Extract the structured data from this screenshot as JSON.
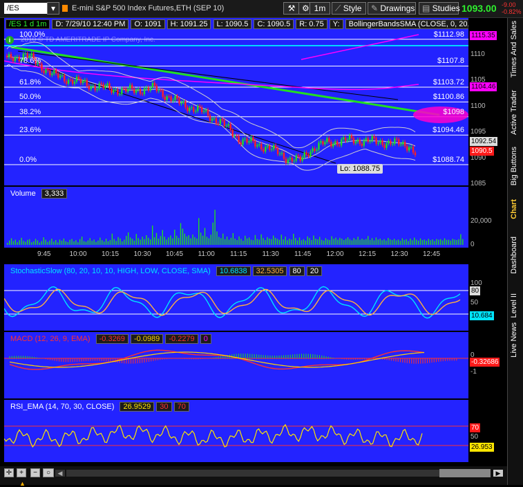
{
  "toolbar": {
    "symbol": "/ES",
    "title": "E-mini S&P 500 Index Futures,ETH (SEP 10)",
    "interval": "1m",
    "style_label": "Style",
    "drawings_label": "Drawings",
    "studies_label": "Studies",
    "last_price": "1093.00",
    "change_top": "-9.00",
    "change_pct": "-0.82%"
  },
  "chart_header": {
    "symbol_tf": "/ES 1 d 1m",
    "date": "D: 7/29/10 12:40 PM",
    "open": "O: 1091",
    "high": "H: 1091.25",
    "low": "L: 1090.5",
    "close": "C: 1090.5",
    "range": "R: 0.75",
    "y": "Y:",
    "study": "BollingerBandsSMA (CLOSE, 0, 20, -2.0, ..."
  },
  "watermark": "2010 © TD AMERITRADE IP Company, Inc.",
  "fib": [
    {
      "pct": "100.0%",
      "price": "$1112.98"
    },
    {
      "pct": "78.6%",
      "price": "$1107.8"
    },
    {
      "pct": "61.8%",
      "price": "$1103.72"
    },
    {
      "pct": "50.0%",
      "price": "$1100.86"
    },
    {
      "pct": "38.2%",
      "price": "$1098"
    },
    {
      "pct": "23.6%",
      "price": "$1094.46"
    },
    {
      "pct": "0.0%",
      "price": "$1088.74"
    }
  ],
  "low_label": "Lo: 1088.75",
  "price_axis": {
    "ticks": [
      "1110",
      "1105",
      "1100",
      "1095",
      "1090",
      "1085"
    ],
    "labels": {
      "top_magenta": "1115.35",
      "magenta_2": "1104.46",
      "bubble": "1092.54",
      "last": "1090.5"
    }
  },
  "volume": {
    "title": "Volume",
    "value": "3,333",
    "axis": [
      "20,000",
      "0"
    ],
    "bars": [
      1200,
      2500,
      3800,
      2200,
      3000,
      1500,
      2700,
      4100,
      2300,
      1800,
      2900,
      3300,
      1500,
      2000,
      3500,
      2600,
      1300,
      2200,
      4400,
      3000,
      1700,
      2500,
      3600,
      1900,
      2800,
      1400,
      3100,
      2400,
      3700,
      2100,
      1600,
      2900,
      3400,
      2000,
      2700,
      1500,
      3300,
      4800,
      2200,
      1800,
      2600,
      3900,
      2300,
      3100,
      1700,
      2500,
      4200,
      2700,
      1900,
      3600,
      2100,
      2800,
      6500,
      3400,
      2300,
      4500,
      3700,
      2000,
      3000,
      5200,
      7200,
      4300,
      3600,
      2500,
      6300,
      3900,
      3000,
      4700,
      3300,
      5600,
      4100,
      3200,
      11200,
      4400,
      6900,
      3600,
      5100,
      8600,
      4700,
      3100,
      4300,
      5400,
      3800,
      8800,
      5300,
      4000,
      12600,
      9400,
      6500,
      4900,
      5600,
      3800,
      6000,
      4500,
      3700,
      15500,
      7100,
      5300,
      9800,
      4700,
      3800,
      5900,
      12900,
      20300,
      7800,
      4600,
      3900,
      6500,
      3300,
      4800,
      3000,
      4100,
      6800,
      3600,
      2800,
      4900,
      3500,
      2400,
      5300,
      3700,
      4300,
      3000,
      2700,
      5700,
      3400,
      3000,
      6100,
      3900,
      2800,
      4500,
      3700,
      3300,
      5400,
      4100,
      3500,
      2900,
      5900,
      3200,
      4800,
      2700,
      3600,
      3100,
      6400,
      3900,
      2600,
      4300,
      2700,
      3300,
      2500,
      4900,
      4000,
      2800,
      5400,
      3600,
      3200,
      4600,
      2900,
      2500,
      3900,
      3100,
      2800,
      5000,
      3500,
      4200,
      3000,
      4100,
      3600,
      2800,
      3500,
      4400,
      3300,
      2600,
      3900,
      3100,
      4700,
      2900,
      3600,
      3000,
      3400,
      5100,
      2800,
      3900,
      2600,
      4300,
      3100,
      3600,
      2700,
      3300,
      2500,
      4000,
      3200,
      2800,
      3500,
      2600,
      3100,
      2400,
      3800,
      2900,
      3300,
      2200,
      3600,
      2700,
      4200,
      3000,
      2500,
      3700,
      2800,
      3100,
      2400,
      3500,
      2700,
      3200,
      2300,
      3400,
      3000,
      3300,
      2600,
      3800,
      2900,
      3000,
      2500,
      3500,
      3100,
      2800,
      3300,
      6200,
      3300
    ]
  },
  "time_axis": [
    "9:45",
    "10:00",
    "10:15",
    "10:30",
    "10:45",
    "11:00",
    "11:15",
    "11:30",
    "11:45",
    "12:00",
    "12:15",
    "12:30",
    "12:45"
  ],
  "stoch": {
    "name": "StochasticSlow (80, 20, 10, 10, HIGH, LOW, CLOSE, SMA)",
    "k": "10.6838",
    "d": "32.5305",
    "ob": "80",
    "os": "20",
    "axis": [
      "100",
      "80",
      "50",
      "10.684"
    ]
  },
  "macd": {
    "name": "MACD (12, 26, 9, EMA)",
    "v1": "-0.3269",
    "v2": "-0.0989",
    "v3": "-0.2279",
    "v4": "0",
    "axis": [
      "0",
      "-0.32686",
      "-1"
    ]
  },
  "rsi": {
    "name": "RSI_EMA (14, 70, 30, CLOSE)",
    "value": "26.9529",
    "os": "30",
    "ob": "70",
    "axis": [
      "70",
      "50",
      "26.953"
    ]
  },
  "side_tabs": [
    "Times And Sales",
    "Active Trader",
    "Big Buttons",
    "Chart",
    "Dashboard",
    "Level II",
    "Live News"
  ],
  "colors": {
    "panel_bg": "#2323ff",
    "up_candle": "#22dd22",
    "down_candle": "#ff2020",
    "price_green": "#2ef12e",
    "magenta": "#ff00ff"
  }
}
